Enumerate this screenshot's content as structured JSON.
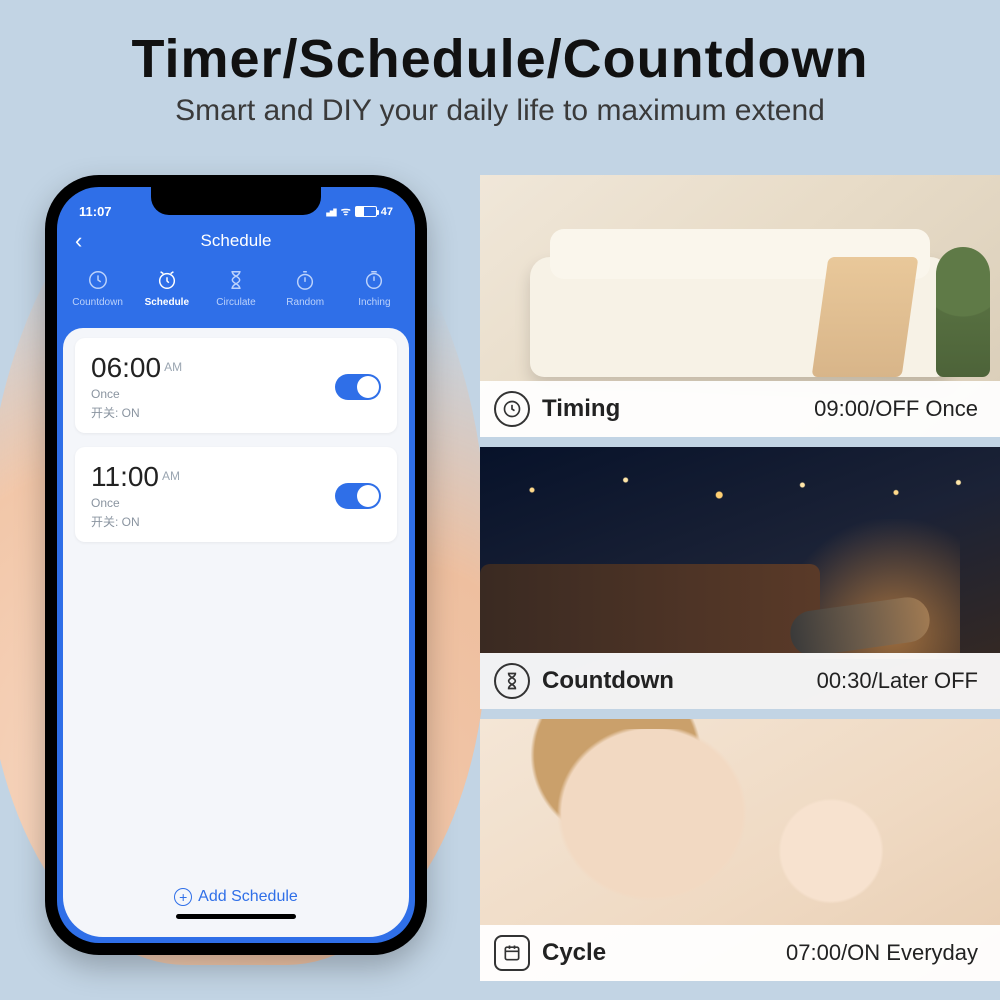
{
  "hero": {
    "title": "Timer/Schedule/Countdown",
    "subtitle": "Smart and DIY your daily life to maximum extend"
  },
  "phone": {
    "status_time": "11:07",
    "battery": "47",
    "nav_title": "Schedule",
    "tabs": [
      {
        "label": "Countdown"
      },
      {
        "label": "Schedule"
      },
      {
        "label": "Circulate"
      },
      {
        "label": "Random"
      },
      {
        "label": "Inching"
      }
    ],
    "items": [
      {
        "time": "06:00",
        "meridiem": "AM",
        "line1": "Once",
        "line2": "开关: ON"
      },
      {
        "time": "11:00",
        "meridiem": "AM",
        "line1": "Once",
        "line2": "开关: ON"
      }
    ],
    "add_label": "Add Schedule"
  },
  "right": [
    {
      "title": "Timing",
      "value": "09:00/OFF Once"
    },
    {
      "title": "Countdown",
      "value": "00:30/Later OFF"
    },
    {
      "title": "Cycle",
      "value": "07:00/ON Everyday"
    }
  ]
}
